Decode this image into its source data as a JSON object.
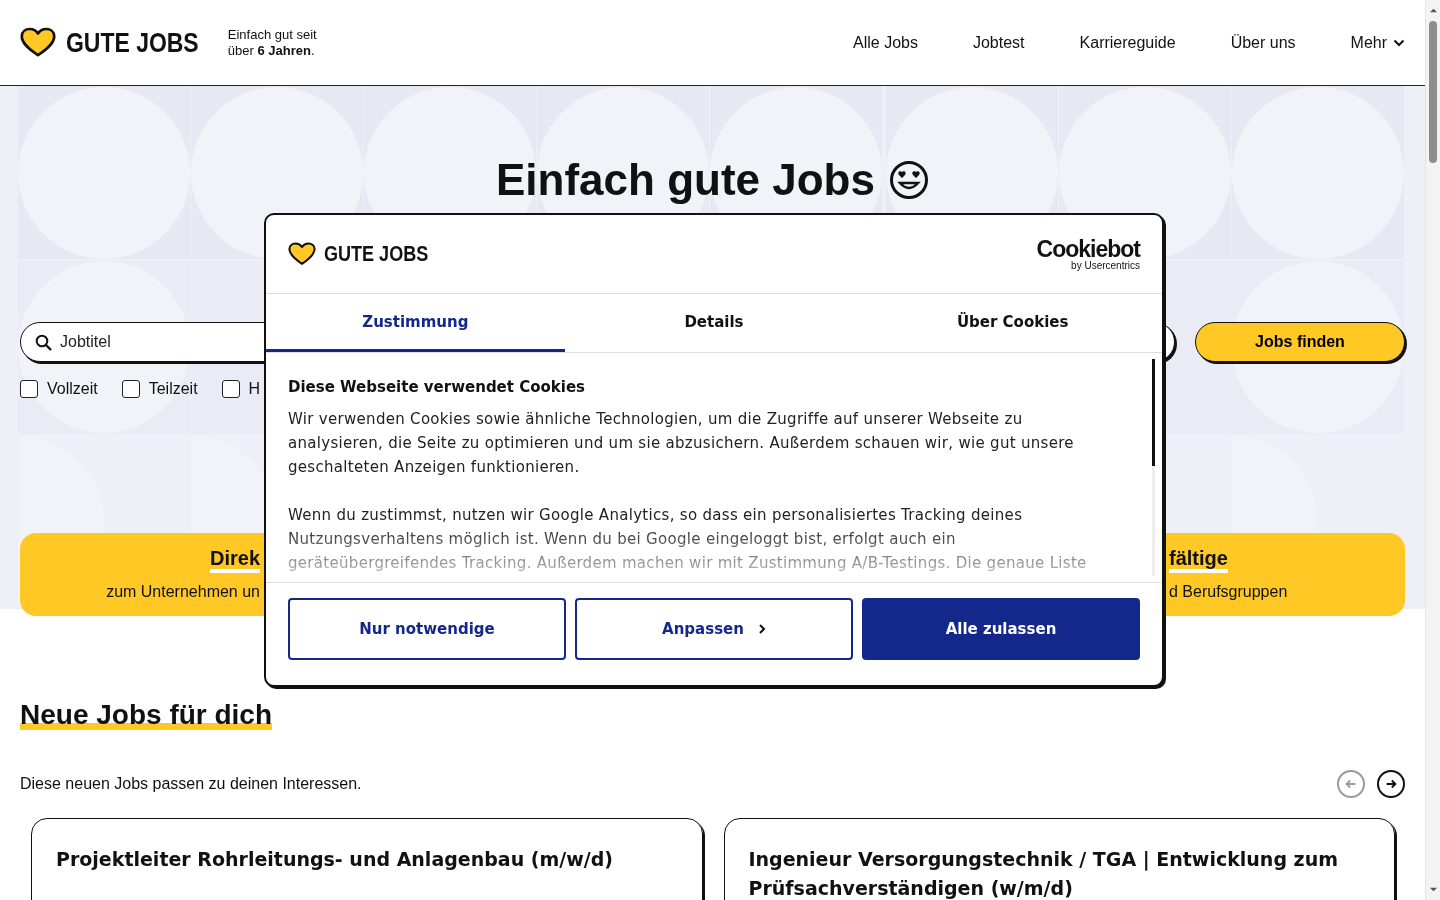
{
  "header": {
    "logo": "GUTE JOBS",
    "tagline": "Einfach gut seit über **6 Jahren**.",
    "nav": [
      {
        "label": "Alle Jobs",
        "kind": "link"
      },
      {
        "label": "Jobtest",
        "kind": "link"
      },
      {
        "label": "Karriereguide",
        "kind": "link"
      },
      {
        "label": "Über uns",
        "kind": "link"
      },
      {
        "label": "Mehr",
        "kind": "dropdown"
      }
    ]
  },
  "hero": {
    "title": "Einfach gute Jobs",
    "search": {
      "placeholder": "Jobtitel"
    },
    "filters": [
      {
        "label": "Vollzeit",
        "checked": false
      },
      {
        "label": "Teilzeit",
        "checked": false
      },
      {
        "label": "H",
        "checked": false
      }
    ],
    "submit": "Jobs finden"
  },
  "banner": {
    "left_title": "Direk",
    "left_text": "zum Unternehmen un",
    "right_title": "fältige",
    "right_text": "d Berufsgruppen"
  },
  "cookie_dialog": {
    "logo": "GUTE JOBS",
    "provider": "Cookiebot",
    "provider_sub": "by Usercentrics",
    "tabs": [
      {
        "label": "Zustimmung",
        "selected": true
      },
      {
        "label": "Details",
        "selected": false
      },
      {
        "label": "Über Cookies",
        "selected": false
      }
    ],
    "heading": "Diese Webseite verwendet Cookies",
    "paragraphs": [
      {
        "text": "Wir verwenden Cookies sowie ähnliche Technologien, um die Zugriffe auf unserer Webseite zu analysieren, die Seite zu optimieren und um sie abzusichern. Außerdem schauen wir, wie gut unsere geschalteten Anzeigen funktionieren.",
        "faded": false
      },
      {
        "text": "Wenn du zustimmst, nutzen wir Google Analytics, so dass ein personalisiertes Tracking deines Nutzungsverhaltens möglich ist. Wenn du bei Google eingeloggt bist, erfolgt auch ein geräteübergreifendes Tracking. Außerdem machen wir mit Zustimmung A/B-Testings. Die genaue Liste",
        "faded": true
      }
    ],
    "buttons": [
      {
        "label": "Nur notwendige",
        "kind": "outline"
      },
      {
        "label": "Anpassen",
        "kind": "outline-chevron"
      },
      {
        "label": "Alle zulassen",
        "kind": "primary"
      }
    ]
  },
  "new_jobs": {
    "title": "Neue Jobs für dich",
    "subtitle": "Diese neuen Jobs passen zu deinen Interessen.",
    "carousel_buttons": [
      {
        "kind": "prev",
        "disabled": true
      },
      {
        "kind": "next",
        "disabled": false
      }
    ],
    "jobs": [
      {
        "title": "Projektleiter Rohrleitungs- und Anlagenbau (m/w/d)"
      },
      {
        "title": "Ingenieur Versorgungstechnik / TGA | Entwicklung zum Prüfsachverständigen (w/m/d)"
      }
    ]
  }
}
